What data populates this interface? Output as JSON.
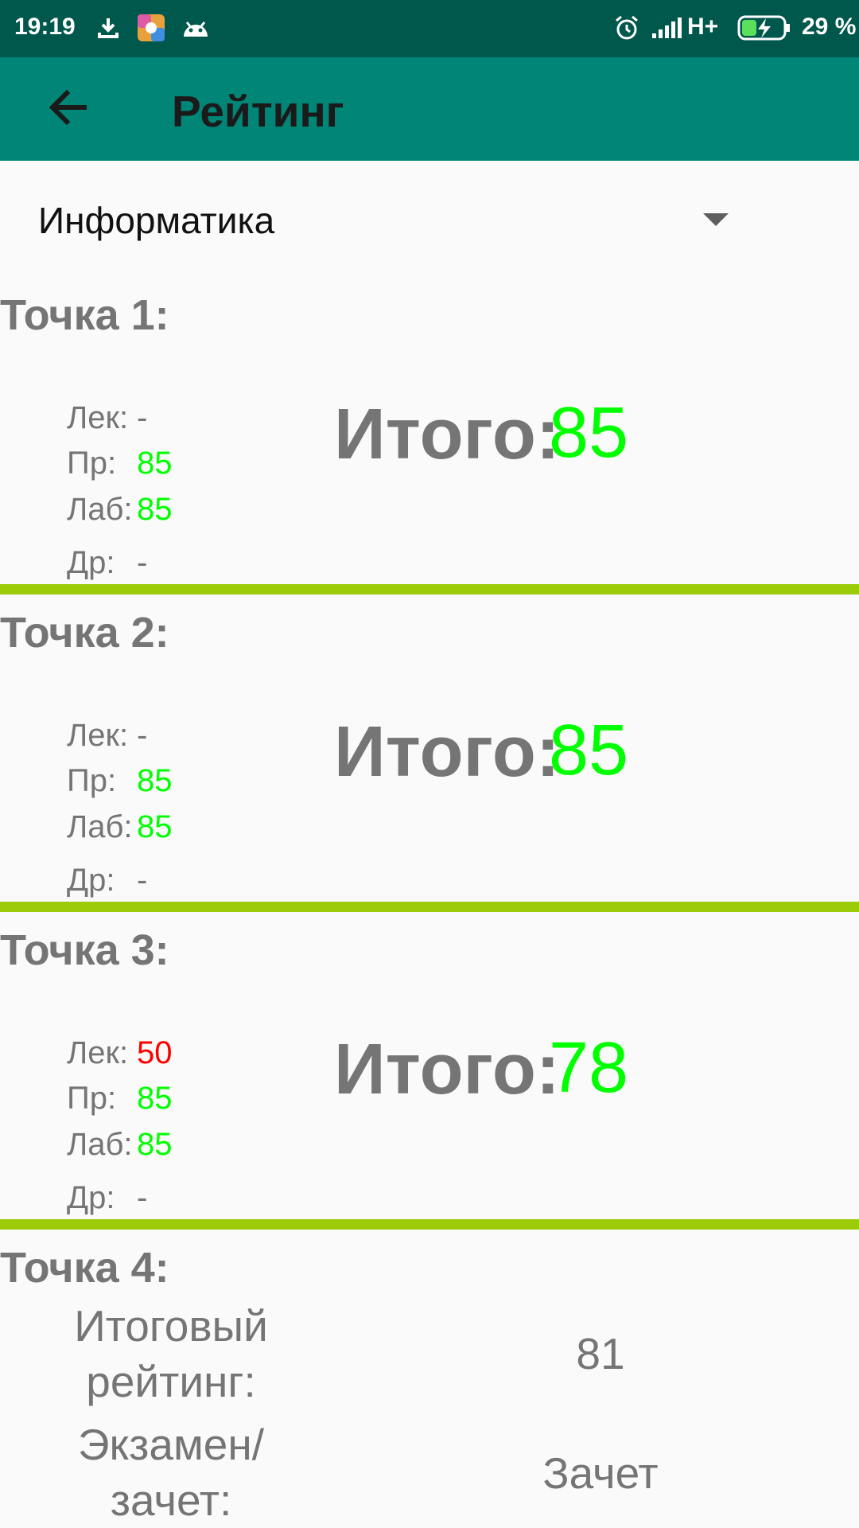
{
  "status_bar": {
    "time": "19:19",
    "network": "H+",
    "battery": "29 %",
    "icons": [
      "download-icon",
      "app-icon",
      "android-icon",
      "alarm-icon",
      "signal-icon",
      "battery-icon"
    ]
  },
  "app_bar": {
    "title": "Рейтинг",
    "back_icon": "arrow-back-icon"
  },
  "subject_select": {
    "value": "Информатика"
  },
  "colors": {
    "good": "#00ff00",
    "bad": "#ff0000",
    "divider": "#9bcb09",
    "app_bar": "#008577",
    "status_bar": "#00574b"
  },
  "labels": {
    "lec": "Лек:",
    "pr": "Пр:",
    "lab": "Лаб:",
    "other": "Др:",
    "total": "Итого:"
  },
  "points": [
    {
      "title": "Точка 1:",
      "lec": "-",
      "pr": "85",
      "lab": "85",
      "other": "-",
      "total": "85",
      "lec_status": "none"
    },
    {
      "title": "Точка 2:",
      "lec": "-",
      "pr": "85",
      "lab": "85",
      "other": "-",
      "total": "85",
      "lec_status": "none"
    },
    {
      "title": "Точка 3:",
      "lec": "50",
      "pr": "85",
      "lab": "85",
      "other": "-",
      "total": "78",
      "lec_status": "bad"
    }
  ],
  "point4": {
    "title": "Точка 4:",
    "final_rating_label_1": "Итоговый",
    "final_rating_label_2": "рейтинг:",
    "final_rating_value": "81",
    "exam_label_1": "Экзамен/",
    "exam_label_2": "зачет:",
    "exam_value": "Зачет"
  }
}
